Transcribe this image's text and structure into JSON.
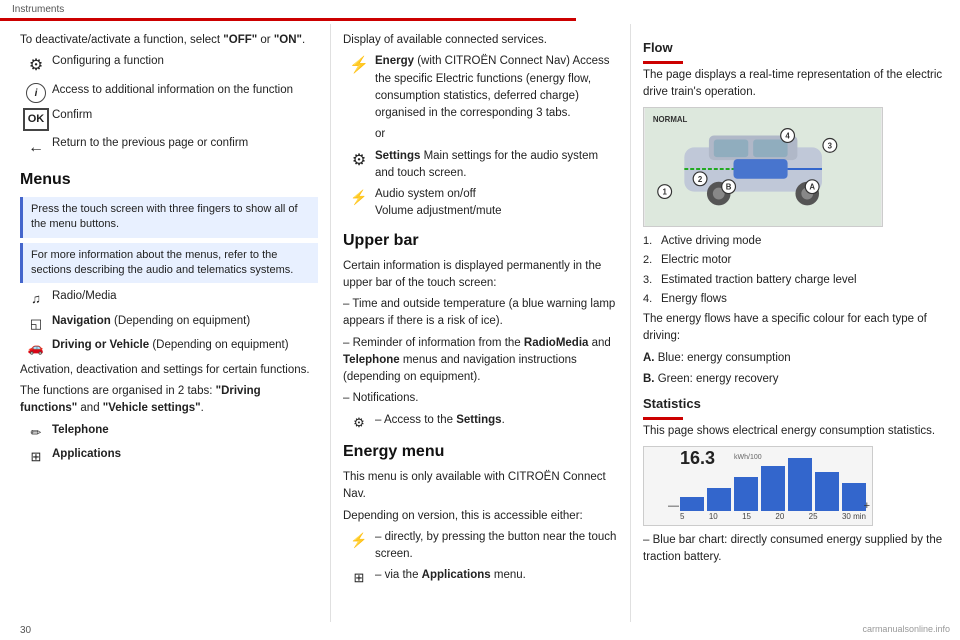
{
  "header": {
    "title": "Instruments",
    "page_number": "30"
  },
  "left_col": {
    "intro": "To deactivate/activate a function, select \"OFF\" or \"ON\".",
    "icons": [
      {
        "icon_type": "gear",
        "text": "Configuring a function"
      },
      {
        "icon_type": "info",
        "text": "Access to additional information on the function"
      },
      {
        "icon_type": "ok",
        "text": "Confirm"
      },
      {
        "icon_type": "back",
        "text": "Return to the previous page or confirm"
      }
    ],
    "menus_heading": "Menus",
    "info_box_1": "Press the touch screen with three fingers to show all of the menu buttons.",
    "info_box_2": "For more information about the menus, refer to the sections describing the audio and telematics systems.",
    "menu_items": [
      {
        "icon": "music",
        "text": "Radio/Media"
      },
      {
        "icon": "nav",
        "text_bold": "Navigation",
        "text_rest": " (Depending on equipment)"
      },
      {
        "icon": "car",
        "text_bold": "Driving or Vehicle",
        "text_rest": " (Depending on equipment)"
      }
    ],
    "activation_text": "Activation, deactivation and settings for certain functions.",
    "tabs_text": "The functions are organised in 2 tabs: ",
    "tabs_bold": "\"Driving functions\"",
    "tabs_and": " and ",
    "tabs_bold2": "\"Vehicle settings\"",
    "tabs_dot": ".",
    "bottom_items": [
      {
        "icon": "phone",
        "text": "Telephone"
      },
      {
        "icon": "grid",
        "text": "Applications"
      }
    ]
  },
  "middle_col": {
    "display_text": "Display of available connected services.",
    "energy_item": {
      "icon": "bolt",
      "label_bold": "Energy",
      "label_rest": " (with CITROËN Connect Nav) Access the specific Electric functions (energy flow, consumption statistics, deferred charge) organised in the corresponding 3 tabs.",
      "or": "or"
    },
    "settings_item": {
      "icon": "gear_settings",
      "label_bold": "Settings",
      "label_rest": " Main settings for the audio system and touch screen."
    },
    "audio_item": {
      "icon": "audio",
      "label": "Audio system on/off Volume adjustment/mute"
    },
    "upper_bar_heading": "Upper bar",
    "upper_bar_text": "Certain information is displayed permanently in the upper bar of the touch screen:",
    "upper_bar_items": [
      "–  Time and outside temperature (a blue warning lamp appears if there is a risk of ice).",
      "–  Reminder of information from the RadioMedia and Telephone menus and navigation instructions (depending on equipment).",
      "–  Notifications."
    ],
    "settings_access": "–  Access to the Settings."
  },
  "right_col": {
    "flow_heading": "Flow",
    "flow_text": "The page displays a real-time representation of the electric drive train's operation.",
    "car_labels": {
      "normal": "NORMAL",
      "nums": [
        "1",
        "2",
        "3",
        "4"
      ],
      "letters": [
        "A",
        "B"
      ]
    },
    "numbered_list": [
      "Active driving mode",
      "Electric motor",
      "Estimated traction battery charge level",
      "Energy flows"
    ],
    "energy_flows_text": "The energy flows have a specific colour for each type of driving:",
    "flow_types": [
      {
        "label_bold": "A.",
        "label_rest": "  Blue: energy consumption"
      },
      {
        "label_bold": "B.",
        "label_rest": "  Green: energy recovery"
      }
    ],
    "statistics_heading": "Statistics",
    "statistics_text": "This page shows electrical energy consumption statistics.",
    "chart": {
      "value": "16.3",
      "unit": "kWh/100",
      "bars": [
        20,
        35,
        50,
        65,
        75,
        60,
        45
      ],
      "x_labels": [
        "5",
        "10",
        "15",
        "20",
        "25",
        "30 min"
      ],
      "y_labels": [
        "",
        ""
      ]
    },
    "chart_note": "–  Blue bar chart: directly consumed energy supplied by the traction battery."
  },
  "watermark": "carmanualsonline.info"
}
